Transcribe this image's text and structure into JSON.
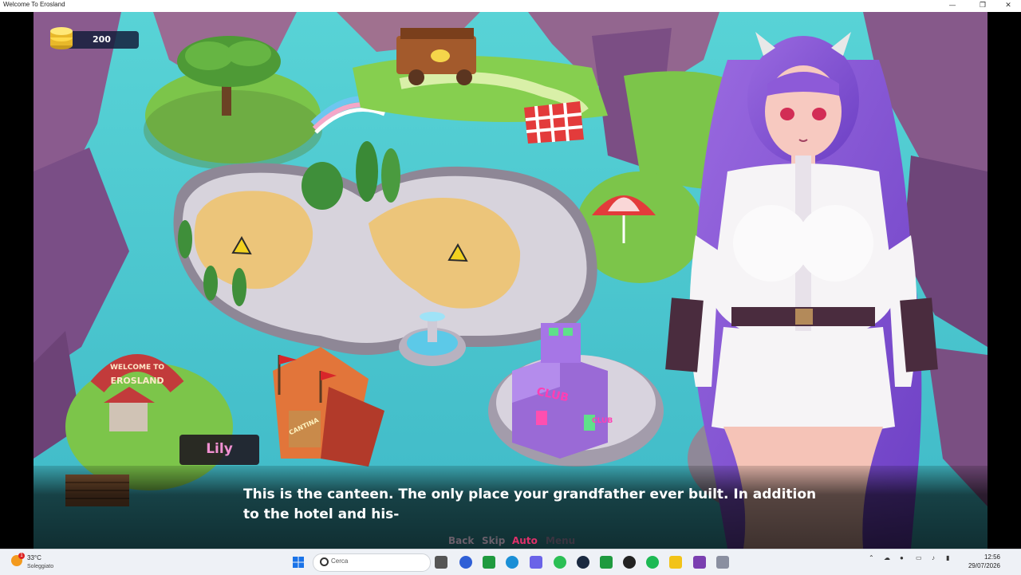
{
  "window": {
    "title": "Welcome To Erosland",
    "minimize_glyph": "—",
    "maximize_glyph": "❐",
    "close_glyph": "✕"
  },
  "hud": {
    "coins": "200",
    "coin_icon": "coin-stack-icon"
  },
  "map": {
    "sign_welcome": "WELCOME TO",
    "sign_name": "EROSLAND",
    "club_sign": "CLUB",
    "club_side_sign": "CLUB",
    "cantina_sign": "CANTINA",
    "construction_icon": "construction-sign-icon"
  },
  "dialogue": {
    "speaker": "Lily",
    "line1": "This is the canteen. The only place your grandfather ever built. In addition",
    "line2": "to the hotel and his-"
  },
  "quick_menu": {
    "back": "Back",
    "skip": "Skip",
    "auto": "Auto",
    "menu": "Menu",
    "auto_color": "#e0306a",
    "inactive_color": "#6a5f6a",
    "menu_color": "#3a3440"
  },
  "taskbar": {
    "weather_temp": "33°C",
    "weather_cond": "Soleggiato",
    "weather_badge": "1",
    "search_placeholder": "Cerca",
    "time": "12:56",
    "date": "29/07/2026",
    "icons": [
      "windows-start-icon",
      "file-explorer-icon",
      "proton-icon",
      "xbox-icon",
      "edge-icon",
      "discord-icon",
      "whatsapp-icon",
      "steam-icon",
      "app-s-icon",
      "github-icon",
      "spotify-icon",
      "notes-icon",
      "game-icon",
      "snipping-icon"
    ],
    "tray_icons": [
      "wifi-icon",
      "onedrive-icon",
      "mic-icon",
      "network-icon",
      "volume-icon",
      "battery-icon"
    ]
  }
}
